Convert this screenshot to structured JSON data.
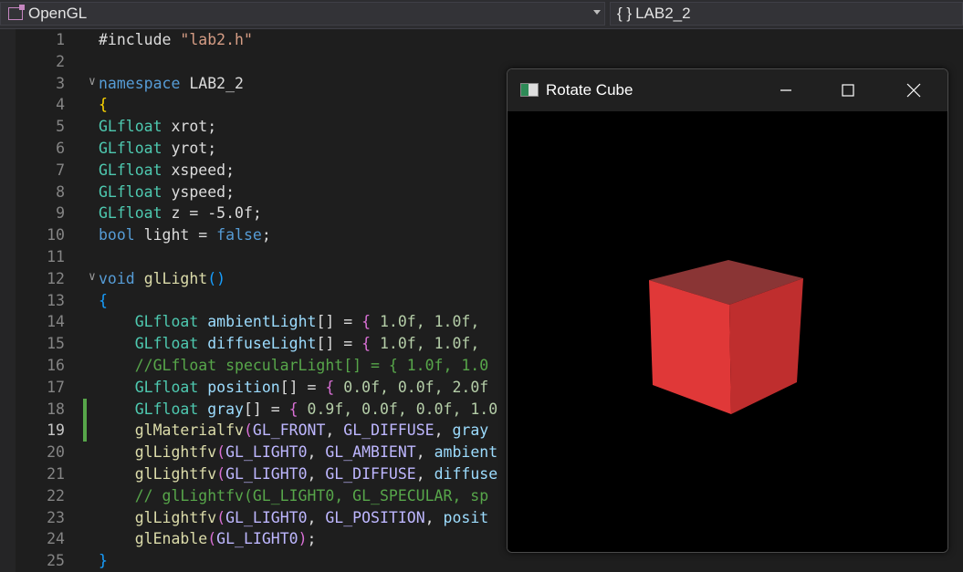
{
  "topbar": {
    "project": "OpenGL",
    "scope": "LAB2_2",
    "scope_icon": "{ }"
  },
  "editor": {
    "lines": [
      {
        "n": "1",
        "tokens": [
          {
            "t": "#include ",
            "c": "pn"
          },
          {
            "t": "\"lab2.h\"",
            "c": "str"
          }
        ]
      },
      {
        "n": "2",
        "tokens": []
      },
      {
        "n": "3",
        "fold": true,
        "tokens": [
          {
            "t": "namespace",
            "c": "kw"
          },
          {
            "t": " LAB2_2",
            "c": "pn"
          }
        ]
      },
      {
        "n": "4",
        "tokens": [
          {
            "t": "{",
            "c": "br1"
          }
        ]
      },
      {
        "n": "5",
        "tokens": [
          {
            "t": "GLfloat",
            "c": "ty"
          },
          {
            "t": " xrot;",
            "c": "pn"
          }
        ]
      },
      {
        "n": "6",
        "tokens": [
          {
            "t": "GLfloat",
            "c": "ty"
          },
          {
            "t": " yrot;",
            "c": "pn"
          }
        ]
      },
      {
        "n": "7",
        "tokens": [
          {
            "t": "GLfloat",
            "c": "ty"
          },
          {
            "t": " xspeed;",
            "c": "pn"
          }
        ]
      },
      {
        "n": "8",
        "tokens": [
          {
            "t": "GLfloat",
            "c": "ty"
          },
          {
            "t": " yspeed;",
            "c": "pn"
          }
        ]
      },
      {
        "n": "9",
        "tokens": [
          {
            "t": "GLfloat",
            "c": "ty"
          },
          {
            "t": " z = -5.0f;",
            "c": "pn"
          }
        ]
      },
      {
        "n": "10",
        "tokens": [
          {
            "t": "bool",
            "c": "kw"
          },
          {
            "t": " light = ",
            "c": "pn"
          },
          {
            "t": "false",
            "c": "kw"
          },
          {
            "t": ";",
            "c": "pn"
          }
        ]
      },
      {
        "n": "11",
        "tokens": []
      },
      {
        "n": "12",
        "fold": true,
        "tokens": [
          {
            "t": "void",
            "c": "kw"
          },
          {
            "t": " ",
            "c": "pn"
          },
          {
            "t": "glLight",
            "c": "fn"
          },
          {
            "t": "()",
            "c": "br3"
          }
        ]
      },
      {
        "n": "13",
        "tokens": [
          {
            "t": "{",
            "c": "br3"
          }
        ]
      },
      {
        "n": "14",
        "tokens": [
          {
            "t": "    ",
            "c": "pn"
          },
          {
            "t": "GLfloat",
            "c": "ty"
          },
          {
            "t": " ",
            "c": "pn"
          },
          {
            "t": "ambientLight",
            "c": "id"
          },
          {
            "t": "[] = ",
            "c": "pn"
          },
          {
            "t": "{",
            "c": "br2"
          },
          {
            "t": " 1.0f, 1.0f, ",
            "c": "num"
          }
        ]
      },
      {
        "n": "15",
        "tokens": [
          {
            "t": "    ",
            "c": "pn"
          },
          {
            "t": "GLfloat",
            "c": "ty"
          },
          {
            "t": " ",
            "c": "pn"
          },
          {
            "t": "diffuseLight",
            "c": "id"
          },
          {
            "t": "[] = ",
            "c": "pn"
          },
          {
            "t": "{",
            "c": "br2"
          },
          {
            "t": " 1.0f, 1.0f, ",
            "c": "num"
          }
        ]
      },
      {
        "n": "16",
        "tokens": [
          {
            "t": "    //GLfloat specularLight[] = { 1.0f, 1.0",
            "c": "cm"
          }
        ]
      },
      {
        "n": "17",
        "tokens": [
          {
            "t": "    ",
            "c": "pn"
          },
          {
            "t": "GLfloat",
            "c": "ty"
          },
          {
            "t": " ",
            "c": "pn"
          },
          {
            "t": "position",
            "c": "id"
          },
          {
            "t": "[] = ",
            "c": "pn"
          },
          {
            "t": "{",
            "c": "br2"
          },
          {
            "t": " 0.0f, 0.0f, 2.0f",
            "c": "num"
          }
        ]
      },
      {
        "n": "18",
        "change": true,
        "tokens": [
          {
            "t": "    ",
            "c": "pn"
          },
          {
            "t": "GLfloat",
            "c": "ty"
          },
          {
            "t": " ",
            "c": "pn"
          },
          {
            "t": "gray",
            "c": "id"
          },
          {
            "t": "[] = ",
            "c": "pn"
          },
          {
            "t": "{",
            "c": "br2"
          },
          {
            "t": " 0.9f, 0.0f, 0.0f, 1.0",
            "c": "num"
          }
        ]
      },
      {
        "n": "19",
        "change": true,
        "active": true,
        "tokens": [
          {
            "t": "    ",
            "c": "pn"
          },
          {
            "t": "glMaterialfv",
            "c": "fn"
          },
          {
            "t": "(",
            "c": "br2"
          },
          {
            "t": "GL_FRONT",
            "c": "mac"
          },
          {
            "t": ", ",
            "c": "pn"
          },
          {
            "t": "GL_DIFFUSE",
            "c": "mac"
          },
          {
            "t": ", ",
            "c": "pn"
          },
          {
            "t": "gray",
            "c": "id"
          }
        ]
      },
      {
        "n": "20",
        "tokens": [
          {
            "t": "    ",
            "c": "pn"
          },
          {
            "t": "glLightfv",
            "c": "fn"
          },
          {
            "t": "(",
            "c": "br2"
          },
          {
            "t": "GL_LIGHT0",
            "c": "mac"
          },
          {
            "t": ", ",
            "c": "pn"
          },
          {
            "t": "GL_AMBIENT",
            "c": "mac"
          },
          {
            "t": ", ",
            "c": "pn"
          },
          {
            "t": "ambient",
            "c": "id"
          }
        ]
      },
      {
        "n": "21",
        "tokens": [
          {
            "t": "    ",
            "c": "pn"
          },
          {
            "t": "glLightfv",
            "c": "fn"
          },
          {
            "t": "(",
            "c": "br2"
          },
          {
            "t": "GL_LIGHT0",
            "c": "mac"
          },
          {
            "t": ", ",
            "c": "pn"
          },
          {
            "t": "GL_DIFFUSE",
            "c": "mac"
          },
          {
            "t": ", ",
            "c": "pn"
          },
          {
            "t": "diffuse",
            "c": "id"
          }
        ]
      },
      {
        "n": "22",
        "tokens": [
          {
            "t": "    // glLightfv(GL_LIGHT0, GL_SPECULAR, sp",
            "c": "cm"
          }
        ]
      },
      {
        "n": "23",
        "tokens": [
          {
            "t": "    ",
            "c": "pn"
          },
          {
            "t": "glLightfv",
            "c": "fn"
          },
          {
            "t": "(",
            "c": "br2"
          },
          {
            "t": "GL_LIGHT0",
            "c": "mac"
          },
          {
            "t": ", ",
            "c": "pn"
          },
          {
            "t": "GL_POSITION",
            "c": "mac"
          },
          {
            "t": ", ",
            "c": "pn"
          },
          {
            "t": "posit",
            "c": "id"
          }
        ]
      },
      {
        "n": "24",
        "tokens": [
          {
            "t": "    ",
            "c": "pn"
          },
          {
            "t": "glEnable",
            "c": "fn"
          },
          {
            "t": "(",
            "c": "br2"
          },
          {
            "t": "GL_LIGHT0",
            "c": "mac"
          },
          {
            "t": ")",
            "c": "br2"
          },
          {
            "t": ";",
            "c": "pn"
          }
        ]
      },
      {
        "n": "25",
        "tokens": [
          {
            "t": "}",
            "c": "br3"
          }
        ]
      }
    ]
  },
  "window": {
    "title": "Rotate Cube",
    "icons": [
      "minimize-icon",
      "maximize-icon",
      "close-icon"
    ]
  },
  "colors": {
    "cube_front": "#e03838",
    "cube_top": "#8a3535",
    "cube_side": "#bf2e2e",
    "change_bar": "#57a64a"
  }
}
